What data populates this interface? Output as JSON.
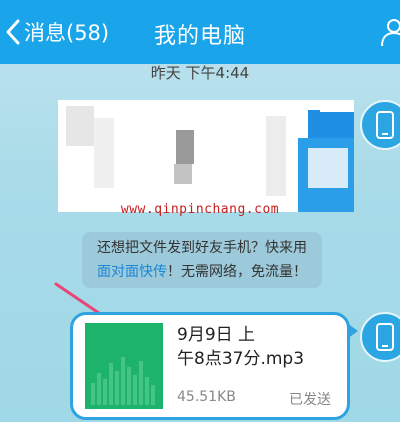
{
  "header": {
    "back_label": "消息(58)",
    "title": "我的电脑",
    "icons": {
      "back": "chevron-left-icon",
      "profile": "person-icon"
    }
  },
  "chat": {
    "timestamp": "昨天 下午4:44",
    "watermark": "www.qinpinchang.com",
    "tip": {
      "line1": "还想把文件发到好友手机？快来用",
      "link": "面对面快传",
      "line2_rest": "！无需网络，免流量！"
    },
    "file_message": {
      "name_line1": "9月9日 上",
      "name_line2": "午8点37分.mp3",
      "size": "45.51KB",
      "status": "已发送",
      "thumb_icon": "audio-waveform-icon"
    }
  },
  "colors": {
    "header_bg": "#1aa5ea",
    "accent": "#2fa3e0",
    "thumb_green": "#1eb36a",
    "link": "#1a86d6",
    "watermark": "#c81e1e",
    "annotation_arrow": "#e8457a"
  }
}
